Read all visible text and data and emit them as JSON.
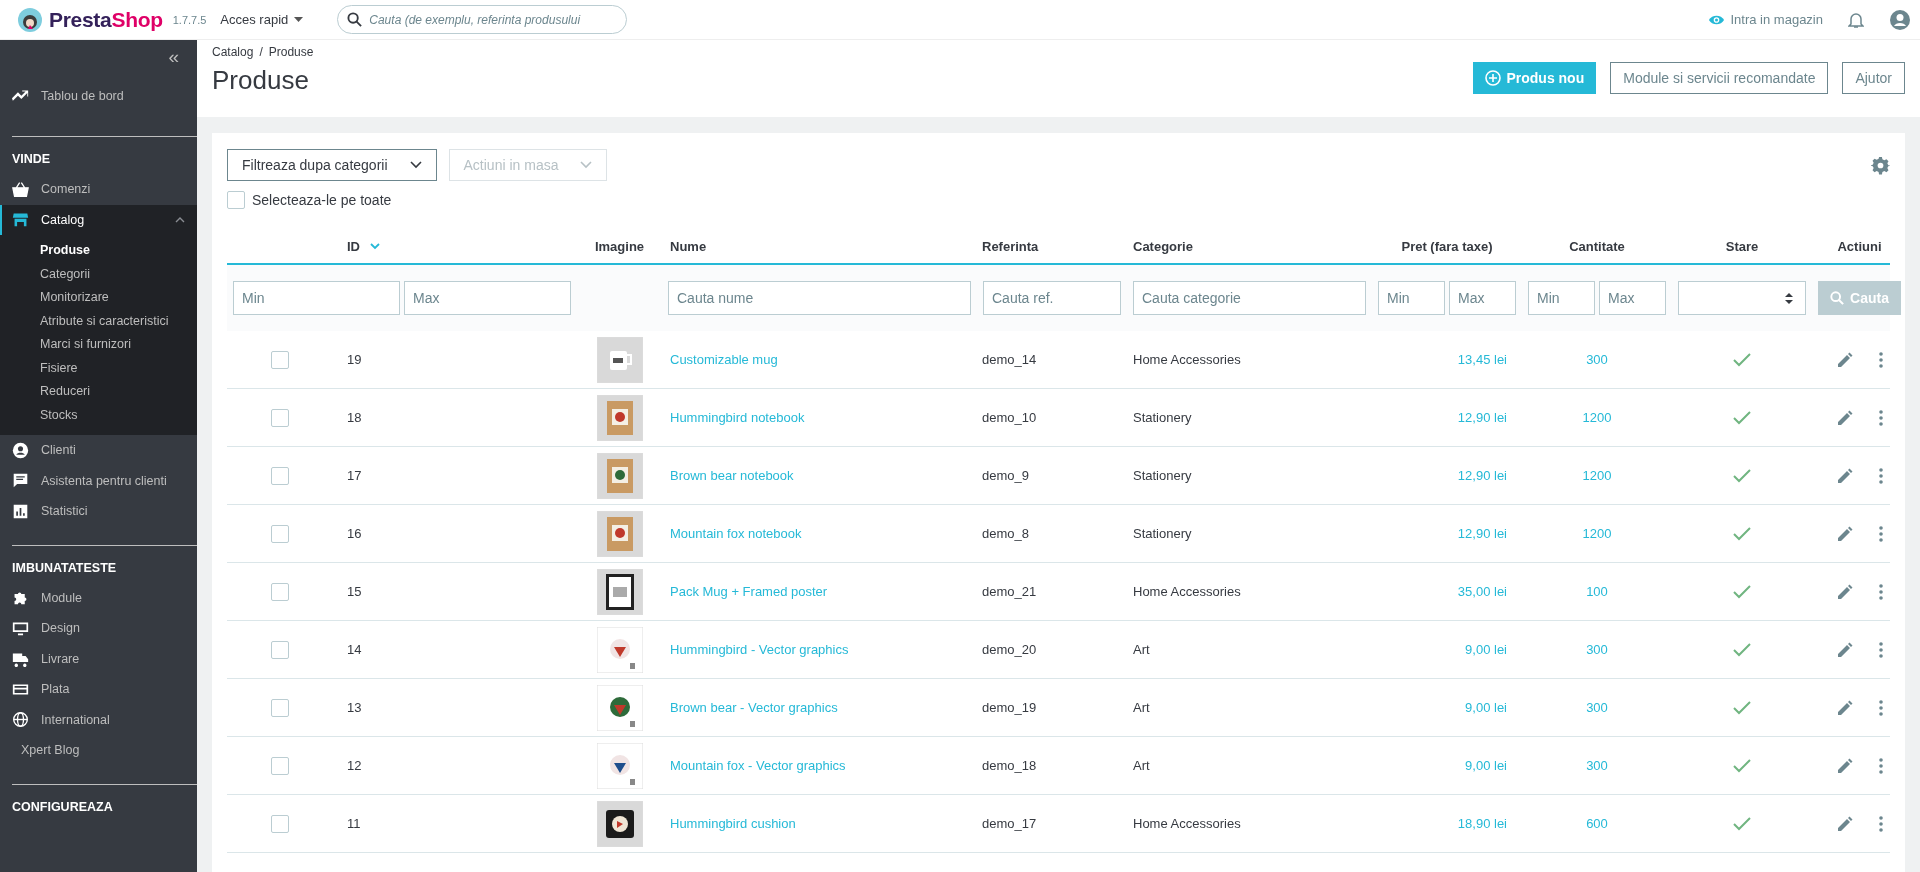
{
  "header": {
    "logo_text": [
      "Presta",
      "Shop"
    ],
    "version": "1.7.7.5",
    "quick_access": "Acces rapid",
    "search": {
      "placeholder": "Cauta (de exemplu, referinta produsului"
    },
    "shop_link": "Intra in magazin"
  },
  "sidebar": {
    "collapse": "«",
    "sections": [
      {
        "items": [
          {
            "label": "Tablou de bord",
            "selected": false
          }
        ]
      },
      {
        "title": "VINDE",
        "items": [
          {
            "label": "Comenzi",
            "selected": false
          },
          {
            "label": "Catalog",
            "selected": true,
            "expanded": true,
            "children": [
              {
                "label": "Produse",
                "selected": true
              },
              {
                "label": "Categorii",
                "selected": false
              },
              {
                "label": "Monitorizare",
                "selected": false
              },
              {
                "label": "Atribute si caracteristici",
                "selected": false
              },
              {
                "label": "Marci si furnizori",
                "selected": false
              },
              {
                "label": "Fisiere",
                "selected": false
              },
              {
                "label": "Reduceri",
                "selected": false
              },
              {
                "label": "Stocks",
                "selected": false
              }
            ]
          },
          {
            "label": "Clienti",
            "selected": false
          },
          {
            "label": "Asistenta pentru clienti",
            "selected": false
          },
          {
            "label": "Statistici",
            "selected": false
          }
        ]
      },
      {
        "title": "IMBUNATATESTE",
        "items": [
          {
            "label": "Module",
            "selected": false
          },
          {
            "label": "Design",
            "selected": false
          },
          {
            "label": "Livrare",
            "selected": false
          },
          {
            "label": "Plata",
            "selected": false
          },
          {
            "label": "International",
            "selected": false
          },
          {
            "label": "Xpert Blog",
            "selected": false
          }
        ]
      },
      {
        "title": "CONFIGUREAZA"
      }
    ]
  },
  "breadcrumb": [
    "Catalog",
    "Produse"
  ],
  "breadcrumb_separator": "/",
  "page_title": "Produse",
  "buttons": [
    {
      "label": "Produs nou",
      "kind": "primary"
    },
    {
      "label": "Module si servicii recomandate",
      "kind": "outline"
    },
    {
      "label": "Ajutor",
      "kind": "outline"
    }
  ],
  "toolbar": {
    "category_filter": {
      "label": "Filtreaza dupa categorii",
      "disabled": false
    },
    "bulk_actions": {
      "label": "Actiuni in masa",
      "disabled": true
    },
    "select_all": {
      "label": "Selecteaza-le pe toate",
      "checked": false
    }
  },
  "table": {
    "columns": [
      {
        "label": "ID",
        "sorted": true
      },
      {
        "label": "Imagine",
        "sorted": false
      },
      {
        "label": "Nume",
        "sorted": false
      },
      {
        "label": "Referinta",
        "sorted": false
      },
      {
        "label": "Categorie",
        "sorted": false
      },
      {
        "label": "Pret (fara taxe)",
        "sorted": false
      },
      {
        "label": "Cantitate",
        "sorted": false
      },
      {
        "label": "Stare",
        "sorted": false
      },
      {
        "label": "Actiuni",
        "sorted": false
      }
    ],
    "filters": {
      "id_min": {
        "placeholder": "Min"
      },
      "id_max": {
        "placeholder": "Max"
      },
      "name": {
        "placeholder": "Cauta nume"
      },
      "reference": {
        "placeholder": "Cauta ref."
      },
      "category": {
        "placeholder": "Cauta categorie"
      },
      "price_min": {
        "placeholder": "Min"
      },
      "price_max": {
        "placeholder": "Max"
      },
      "qty_min": {
        "placeholder": "Min"
      },
      "qty_max": {
        "placeholder": "Max"
      },
      "search_button": {
        "label": "Cauta",
        "disabled": true
      }
    },
    "rows": [
      {
        "checked": false,
        "id": "19",
        "name": "Customizable mug",
        "reference": "demo_14",
        "category": "Home Accessories",
        "price": "13,45 lei",
        "quantity": "300",
        "active": true
      },
      {
        "checked": false,
        "id": "18",
        "name": "Hummingbird notebook",
        "reference": "demo_10",
        "category": "Stationery",
        "price": "12,90 lei",
        "quantity": "1200",
        "active": true
      },
      {
        "checked": false,
        "id": "17",
        "name": "Brown bear notebook",
        "reference": "demo_9",
        "category": "Stationery",
        "price": "12,90 lei",
        "quantity": "1200",
        "active": true
      },
      {
        "checked": false,
        "id": "16",
        "name": "Mountain fox notebook",
        "reference": "demo_8",
        "category": "Stationery",
        "price": "12,90 lei",
        "quantity": "1200",
        "active": true
      },
      {
        "checked": false,
        "id": "15",
        "name": "Pack Mug + Framed poster",
        "reference": "demo_21",
        "category": "Home Accessories",
        "price": "35,00 lei",
        "quantity": "100",
        "active": true
      },
      {
        "checked": false,
        "id": "14",
        "name": "Hummingbird - Vector graphics",
        "reference": "demo_20",
        "category": "Art",
        "price": "9,00 lei",
        "quantity": "300",
        "active": true
      },
      {
        "checked": false,
        "id": "13",
        "name": "Brown bear - Vector graphics",
        "reference": "demo_19",
        "category": "Art",
        "price": "9,00 lei",
        "quantity": "300",
        "active": true
      },
      {
        "checked": false,
        "id": "12",
        "name": "Mountain fox - Vector graphics",
        "reference": "demo_18",
        "category": "Art",
        "price": "9,00 lei",
        "quantity": "300",
        "active": true
      },
      {
        "checked": false,
        "id": "11",
        "name": "Hummingbird cushion",
        "reference": "demo_17",
        "category": "Home Accessories",
        "price": "18,90 lei",
        "quantity": "600",
        "active": true
      }
    ]
  }
}
